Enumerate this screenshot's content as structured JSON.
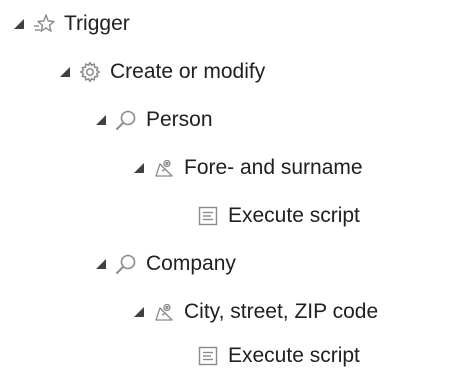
{
  "tree": {
    "trigger": {
      "label": "Trigger",
      "icon": "trigger-star-icon"
    },
    "create_or_modify": {
      "label": "Create or modify",
      "icon": "gear-icon"
    },
    "person": {
      "label": "Person",
      "icon": "search-icon"
    },
    "fore_and_surname": {
      "label": "Fore- and surname",
      "icon": "field-mapping-icon"
    },
    "person_execute_script": {
      "label": "Execute script",
      "icon": "script-icon"
    },
    "company": {
      "label": "Company",
      "icon": "search-icon"
    },
    "city_street_zip": {
      "label": "City, street, ZIP code",
      "icon": "field-mapping-icon"
    },
    "company_execute_script": {
      "label": "Execute script",
      "icon": "script-icon"
    }
  },
  "colors": {
    "text": "#202020",
    "icon": "#8a8a8a",
    "toggle": "#404040"
  }
}
